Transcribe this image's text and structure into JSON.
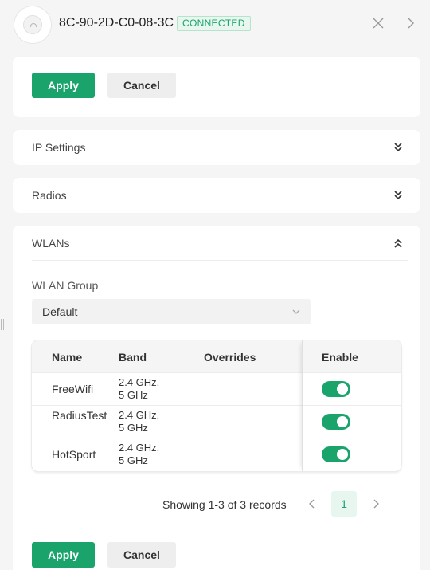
{
  "header": {
    "title": "8C-90-2D-C0-08-3C",
    "status": "CONNECTED",
    "close_icon": "close-icon",
    "next_icon": "chevron-right-icon"
  },
  "actions_top": {
    "apply": "Apply",
    "cancel": "Cancel"
  },
  "sections": {
    "ip_settings": "IP Settings",
    "radios": "Radios",
    "wlans": "WLANs"
  },
  "wlans": {
    "group_label": "WLAN Group",
    "group_value": "Default",
    "columns": {
      "name": "Name",
      "band": "Band",
      "overrides": "Overrides",
      "enable": "Enable"
    },
    "rows": [
      {
        "name": "FreeWifi",
        "band_line1": "2.4 GHz,",
        "band_line2": "5 GHz",
        "overrides": "",
        "enabled": true
      },
      {
        "name": "RadiusTest",
        "band_line1": "2.4 GHz,",
        "band_line2": "5 GHz",
        "overrides": "",
        "enabled": true
      },
      {
        "name": "HotSport",
        "band_line1": "2.4 GHz,",
        "band_line2": "5 GHz",
        "overrides": "",
        "enabled": true
      }
    ],
    "records": "Showing 1-3 of 3 records",
    "current_page": "1"
  },
  "actions_bottom": {
    "apply": "Apply",
    "cancel": "Cancel"
  },
  "colors": {
    "accent": "#1aa36b",
    "badge_bg": "#e7f7ef",
    "page_bg": "#f5f5f5"
  }
}
